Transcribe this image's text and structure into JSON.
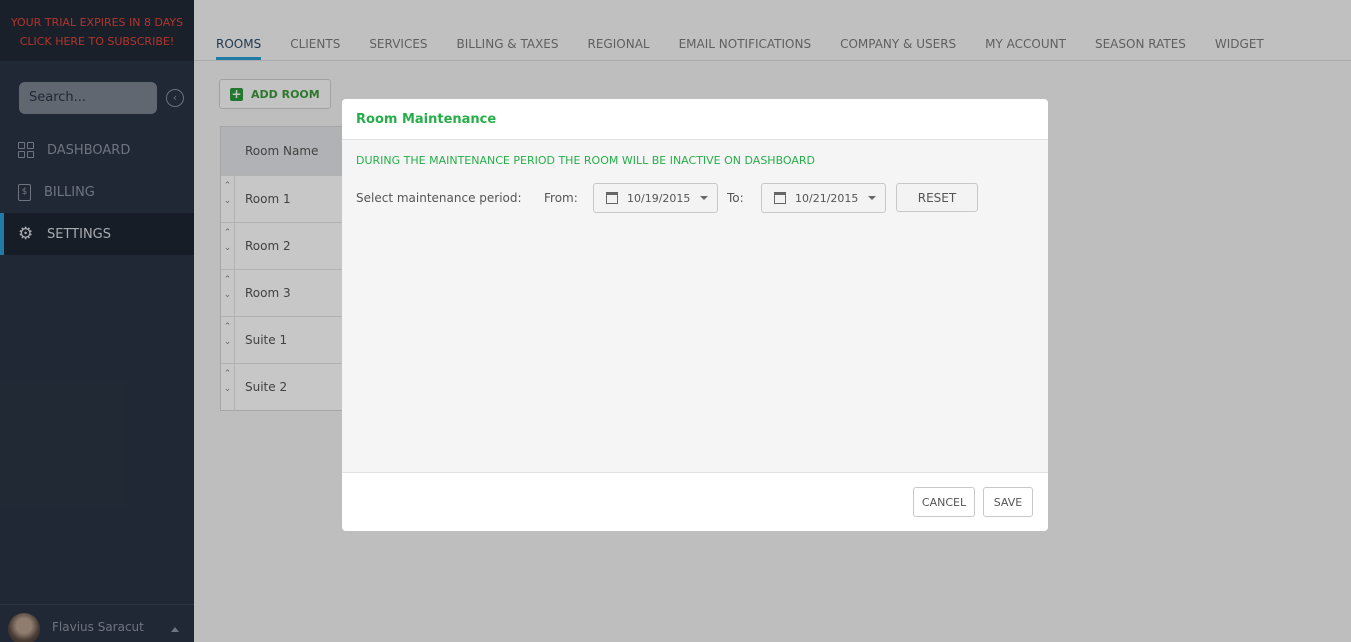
{
  "sidebar": {
    "trial_line1": "YOUR TRIAL EXPIRES IN 8 DAYS",
    "trial_line2": "CLICK HERE TO SUBSCRIBE!",
    "search_placeholder": "Search...",
    "collapse_glyph": "‹",
    "items": [
      {
        "label": "DASHBOARD",
        "icon": "grid-icon"
      },
      {
        "label": "BILLING",
        "icon": "billing-icon"
      },
      {
        "label": "SETTINGS",
        "icon": "gear-icon",
        "active": true
      }
    ],
    "user_name": "Flavius Saracut"
  },
  "tabs": [
    "ROOMS",
    "CLIENTS",
    "SERVICES",
    "BILLING & TAXES",
    "REGIONAL",
    "EMAIL NOTIFICATIONS",
    "COMPANY & USERS",
    "MY ACCOUNT",
    "SEASON RATES",
    "WIDGET"
  ],
  "active_tab": "ROOMS",
  "add_room_label": "ADD ROOM",
  "rooms_table": {
    "header": "Room Name",
    "rows": [
      "Room 1",
      "Room 2",
      "Room 3",
      "Suite 1",
      "Suite 2"
    ]
  },
  "modal": {
    "title": "Room Maintenance",
    "notice": "DURING THE MAINTENANCE PERIOD THE ROOM WILL BE INACTIVE ON DASHBOARD",
    "period_label": "Select maintenance period:",
    "from_label": "From:",
    "from_date": "10/19/2015",
    "to_label": "To:",
    "to_date": "10/21/2015",
    "reset_label": "RESET",
    "cancel_label": "CANCEL",
    "save_label": "SAVE"
  },
  "colors": {
    "sidebar_bg": "#2a3444",
    "trial_text": "#e2443a",
    "accent_blue": "#2a9fd6",
    "accent_green": "#27ae4a"
  }
}
